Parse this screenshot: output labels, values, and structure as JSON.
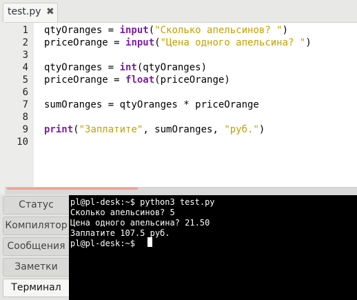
{
  "tab": {
    "title": "test.py",
    "close_label": "✖"
  },
  "editor": {
    "line_numbers": [
      "1",
      "2",
      "3",
      "4",
      "5",
      "6",
      "7",
      "8",
      "9",
      "10"
    ],
    "lines": [
      [
        {
          "t": "qtyOranges = ",
          "c": "plain"
        },
        {
          "t": "input",
          "c": "fn"
        },
        {
          "t": "(",
          "c": "plain"
        },
        {
          "t": "\"Сколько апельсинов? \"",
          "c": "str"
        },
        {
          "t": ")",
          "c": "plain"
        }
      ],
      [
        {
          "t": "priceOrange = ",
          "c": "plain"
        },
        {
          "t": "input",
          "c": "fn"
        },
        {
          "t": "(",
          "c": "plain"
        },
        {
          "t": "\"Цена одного апельсина? \"",
          "c": "str"
        },
        {
          "t": ")",
          "c": "plain"
        }
      ],
      [],
      [
        {
          "t": "qtyOranges = ",
          "c": "plain"
        },
        {
          "t": "int",
          "c": "fn"
        },
        {
          "t": "(qtyOranges)",
          "c": "plain"
        }
      ],
      [
        {
          "t": "priceOrange = ",
          "c": "plain"
        },
        {
          "t": "float",
          "c": "fn"
        },
        {
          "t": "(priceOrange)",
          "c": "plain"
        }
      ],
      [],
      [
        {
          "t": "sumOranges = qtyOranges * priceOrange",
          "c": "plain"
        }
      ],
      [],
      [
        {
          "t": "print",
          "c": "fn"
        },
        {
          "t": "(",
          "c": "plain"
        },
        {
          "t": "\"Заплатите\"",
          "c": "str"
        },
        {
          "t": ", sumOranges, ",
          "c": "plain"
        },
        {
          "t": "\"руб.\"",
          "c": "str"
        },
        {
          "t": ")",
          "c": "plain"
        }
      ],
      []
    ]
  },
  "side_tabs": [
    "Статус",
    "Компилятор",
    "Сообщения",
    "Заметки",
    "Терминал"
  ],
  "active_side_tab": "Терминал",
  "terminal": {
    "lines": [
      "pl@pl-desk:~$ python3 test.py",
      "Сколько апельсинов? 5",
      "Цена одного апельсина? 21.50",
      "Заплатите 107.5 руб.",
      "pl@pl-desk:~$ "
    ]
  },
  "colors": {
    "keyword": "#7a1fa6",
    "string": "#c4a000",
    "terminal_bg": "#000000"
  }
}
